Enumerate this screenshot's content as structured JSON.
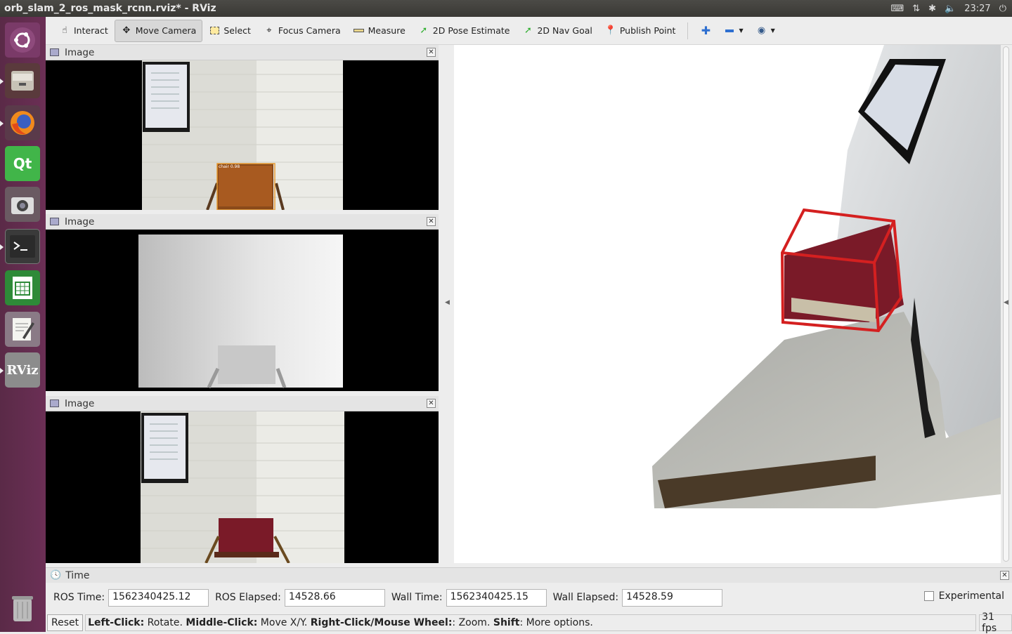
{
  "window": {
    "title": "orb_slam_2_ros_mask_rcnn.rviz* - RViz"
  },
  "tray": {
    "keyboard_icon": "keyboard-icon",
    "network_icon": "network-icon",
    "bluetooth_icon": "bluetooth-icon",
    "volume_icon": "volume-icon",
    "clock": "23:27",
    "power_icon": "power-icon"
  },
  "launcher": {
    "items": [
      "ubuntu-logo",
      "files",
      "firefox",
      "qt-creator",
      "cheese-camera",
      "terminal",
      "libreoffice-calc",
      "text-editor",
      "rviz",
      "trash"
    ],
    "rviz_label": "RViz",
    "qt_label": "Qt"
  },
  "toolbar": {
    "interact": "Interact",
    "move_camera": "Move Camera",
    "select": "Select",
    "focus_camera": "Focus Camera",
    "measure": "Measure",
    "pose_estimate": "2D Pose Estimate",
    "nav_goal": "2D Nav Goal",
    "publish_point": "Publish Point"
  },
  "panels": {
    "image1": {
      "title": "Image",
      "detection_label": "chair 0.98"
    },
    "image2": {
      "title": "Image"
    },
    "image3": {
      "title": "Image"
    }
  },
  "time_panel": {
    "title": "Time",
    "ros_time_label": "ROS Time:",
    "ros_time": "1562340425.12",
    "ros_elapsed_label": "ROS Elapsed:",
    "ros_elapsed": "14528.66",
    "wall_time_label": "Wall Time:",
    "wall_time": "1562340425.15",
    "wall_elapsed_label": "Wall Elapsed:",
    "wall_elapsed": "14528.59",
    "experimental_label": "Experimental",
    "experimental_checked": false
  },
  "status": {
    "reset": "Reset",
    "lc": "Left-Click:",
    "lc_text": " Rotate. ",
    "mc": "Middle-Click:",
    "mc_text": " Move X/Y. ",
    "rc": "Right-Click/Mouse Wheel:",
    "rc_text": ": Zoom. ",
    "shift": "Shift",
    "shift_text": ": More options.",
    "fps": "31 fps"
  },
  "colors": {
    "bounding_box": "#d42020",
    "launcher_bg": "#5e2b4c",
    "chair": "#8a1a2a"
  }
}
